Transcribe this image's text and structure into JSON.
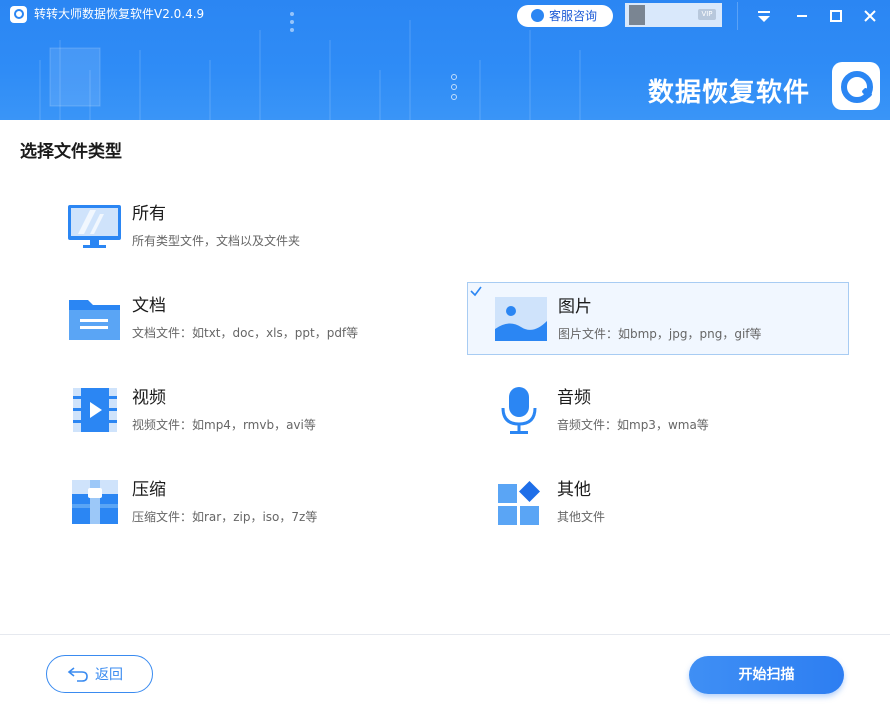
{
  "app": {
    "title": "转转大师数据恢复软件V2.0.4.9",
    "service_label": "客服咨询",
    "vip_label": "VIP",
    "brand_text": "数据恢复软件",
    "window_controls": [
      "menu-icon",
      "minimize-icon",
      "maximize-icon",
      "close-icon"
    ]
  },
  "section": {
    "title": "选择文件类型"
  },
  "file_types": [
    {
      "id": "all",
      "title": "所有",
      "desc": "所有类型文件，文档以及文件夹",
      "icon": "monitor-icon",
      "selected": false
    },
    {
      "id": "document",
      "title": "文档",
      "desc": "文档文件：如txt，doc，xls，ppt，pdf等",
      "icon": "folder-icon",
      "selected": false
    },
    {
      "id": "image",
      "title": "图片",
      "desc": "图片文件：如bmp，jpg，png，gif等",
      "icon": "image-icon",
      "selected": true
    },
    {
      "id": "video",
      "title": "视频",
      "desc": "视频文件：如mp4，rmvb，avi等",
      "icon": "video-icon",
      "selected": false
    },
    {
      "id": "audio",
      "title": "音频",
      "desc": "音频文件：如mp3，wma等",
      "icon": "microphone-icon",
      "selected": false
    },
    {
      "id": "archive",
      "title": "压缩",
      "desc": "压缩文件：如rar，zip，iso，7z等",
      "icon": "archive-icon",
      "selected": false
    },
    {
      "id": "other",
      "title": "其他",
      "desc": "其他文件",
      "icon": "grid-icon",
      "selected": false
    }
  ],
  "footer": {
    "back_label": "返回",
    "scan_label": "开始扫描"
  },
  "colors": {
    "primary": "#2b86f3",
    "selected_bg": "#f1f7ff",
    "selected_border": "#a8ccf3"
  }
}
